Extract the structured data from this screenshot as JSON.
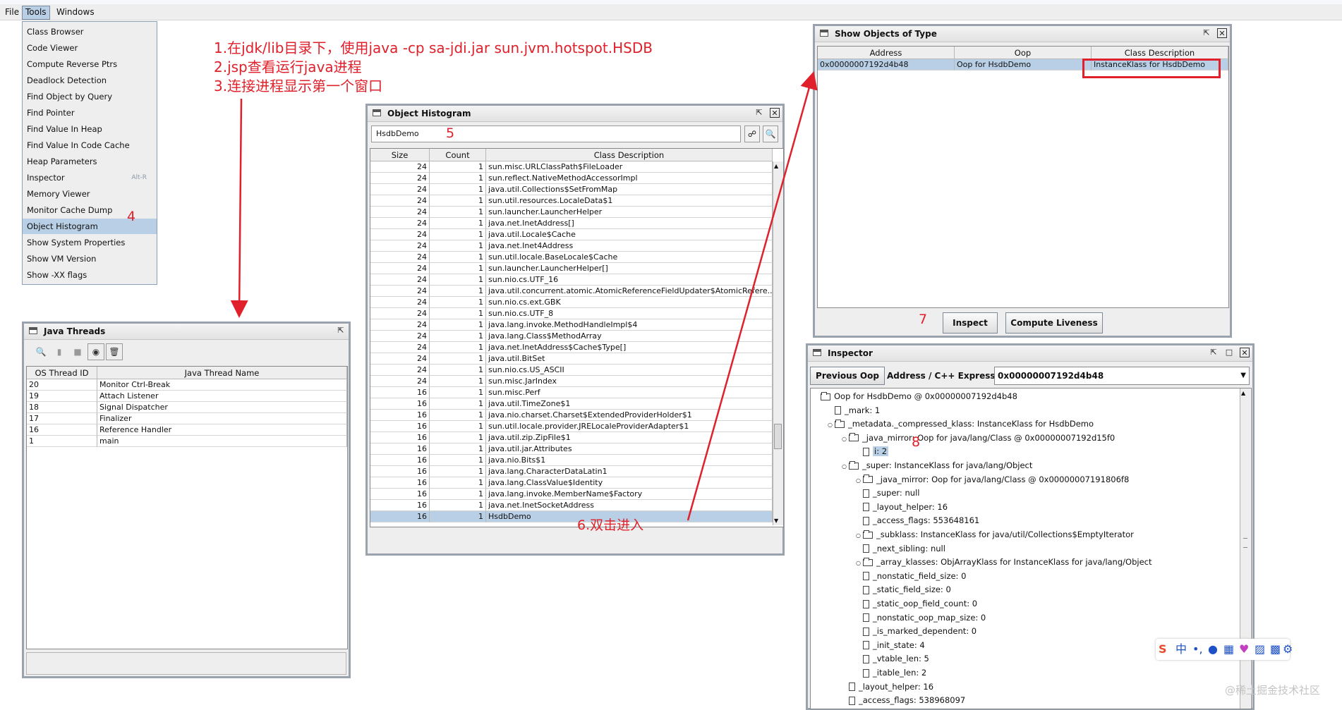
{
  "menubar": {
    "items": [
      {
        "label": "File",
        "active": false
      },
      {
        "label": "Tools",
        "active": true
      },
      {
        "label": "Windows",
        "active": false
      }
    ]
  },
  "tools_menu": {
    "items": [
      {
        "label": "Class Browser"
      },
      {
        "label": "Code Viewer"
      },
      {
        "label": "Compute Reverse Ptrs"
      },
      {
        "label": "Deadlock Detection"
      },
      {
        "label": "Find Object by Query"
      },
      {
        "label": "Find Pointer"
      },
      {
        "label": "Find Value In Heap"
      },
      {
        "label": "Find Value In Code Cache"
      },
      {
        "label": "Heap Parameters"
      },
      {
        "label": "Inspector",
        "accelerator": "Alt-R"
      },
      {
        "label": "Memory Viewer"
      },
      {
        "label": "Monitor Cache Dump"
      },
      {
        "label": "Object Histogram",
        "selected": true
      },
      {
        "label": "Show System Properties"
      },
      {
        "label": "Show VM Version"
      },
      {
        "label": "Show -XX flags"
      }
    ]
  },
  "annotations": {
    "steps_line1": "1.在jdk/lib目录下，使用java -cp sa-jdi.jar sun.jvm.hotspot.HSDB",
    "steps_line2": "2.jsp查看运行java进程",
    "steps_line3": "3.连接进程显示第一个窗口",
    "n4": "4",
    "n5": "5",
    "n6": "6.双击进入",
    "n7": "7",
    "n8": "8",
    "color": "#e0202a"
  },
  "java_threads": {
    "title": "Java Threads",
    "columns": [
      "OS Thread ID",
      "Java Thread Name"
    ],
    "rows": [
      [
        "20",
        "Monitor Ctrl-Break"
      ],
      [
        "19",
        "Attach Listener"
      ],
      [
        "18",
        "Signal Dispatcher"
      ],
      [
        "17",
        "Finalizer"
      ],
      [
        "16",
        "Reference Handler"
      ],
      [
        "1",
        "main"
      ]
    ]
  },
  "histogram": {
    "title": "Object Histogram",
    "search_value": "HsdbDemo",
    "columns": [
      "Size",
      "Count",
      "Class Description"
    ],
    "rows": [
      [
        "24",
        "1",
        "sun.misc.URLClassPath$FileLoader"
      ],
      [
        "24",
        "1",
        "sun.reflect.NativeMethodAccessorImpl"
      ],
      [
        "24",
        "1",
        "java.util.Collections$SetFromMap"
      ],
      [
        "24",
        "1",
        "sun.util.resources.LocaleData$1"
      ],
      [
        "24",
        "1",
        "sun.launcher.LauncherHelper"
      ],
      [
        "24",
        "1",
        "java.net.InetAddress[]"
      ],
      [
        "24",
        "1",
        "java.util.Locale$Cache"
      ],
      [
        "24",
        "1",
        "java.net.Inet4Address"
      ],
      [
        "24",
        "1",
        "sun.util.locale.BaseLocale$Cache"
      ],
      [
        "24",
        "1",
        "sun.launcher.LauncherHelper[]"
      ],
      [
        "24",
        "1",
        "sun.nio.cs.UTF_16"
      ],
      [
        "24",
        "1",
        "java.util.concurrent.atomic.AtomicReferenceFieldUpdater$AtomicRefere..."
      ],
      [
        "24",
        "1",
        "sun.nio.cs.ext.GBK"
      ],
      [
        "24",
        "1",
        "sun.nio.cs.UTF_8"
      ],
      [
        "24",
        "1",
        "java.lang.invoke.MethodHandleImpl$4"
      ],
      [
        "24",
        "1",
        "java.lang.Class$MethodArray"
      ],
      [
        "24",
        "1",
        "java.net.InetAddress$Cache$Type[]"
      ],
      [
        "24",
        "1",
        "java.util.BitSet"
      ],
      [
        "24",
        "1",
        "sun.nio.cs.US_ASCII"
      ],
      [
        "24",
        "1",
        "sun.misc.JarIndex"
      ],
      [
        "16",
        "1",
        "sun.misc.Perf"
      ],
      [
        "16",
        "1",
        "java.util.TimeZone$1"
      ],
      [
        "16",
        "1",
        "java.nio.charset.Charset$ExtendedProviderHolder$1"
      ],
      [
        "16",
        "1",
        "sun.util.locale.provider.JRELocaleProviderAdapter$1"
      ],
      [
        "16",
        "1",
        "java.util.zip.ZipFile$1"
      ],
      [
        "16",
        "1",
        "java.util.jar.Attributes"
      ],
      [
        "16",
        "1",
        "java.nio.Bits$1"
      ],
      [
        "16",
        "1",
        "java.lang.CharacterDataLatin1"
      ],
      [
        "16",
        "1",
        "java.lang.ClassValue$Identity"
      ],
      [
        "16",
        "1",
        "java.lang.invoke.MemberName$Factory"
      ],
      [
        "16",
        "1",
        "java.net.InetSocketAddress"
      ],
      [
        "16",
        "1",
        "HsdbDemo"
      ]
    ],
    "selected_row": 31
  },
  "show_objects": {
    "title": "Show Objects of Type",
    "columns": [
      "Address",
      "Oop",
      "Class Description"
    ],
    "rows": [
      [
        "0x00000007192d4b48",
        "Oop for HsdbDemo",
        "InstanceKlass for HsdbDemo"
      ]
    ],
    "inspect_label": "Inspect",
    "compute_label": "Compute Liveness"
  },
  "inspector": {
    "title": "Inspector",
    "prev_label": "Previous Oop",
    "expr_label": "Address / C++ Expression:",
    "expr_value": "0x00000007192d4b48",
    "tree": [
      {
        "indent": 0,
        "icon": "folder",
        "exp": "",
        "text": "Oop for HsdbDemo @ 0x00000007192d4b48"
      },
      {
        "indent": 1,
        "icon": "doc",
        "exp": "",
        "text": "_mark: 1"
      },
      {
        "indent": 1,
        "icon": "folder",
        "exp": "o",
        "text": "_metadata._compressed_klass: InstanceKlass for HsdbDemo"
      },
      {
        "indent": 2,
        "icon": "folder",
        "exp": "o",
        "text": "_java_mirror: Oop for java/lang/Class @ 0x00000007192d15f0"
      },
      {
        "indent": 3,
        "icon": "doc",
        "exp": "",
        "text": "i: 2",
        "hl": true
      },
      {
        "indent": 2,
        "icon": "folder",
        "exp": "o",
        "text": "_super: InstanceKlass for java/lang/Object"
      },
      {
        "indent": 3,
        "icon": "folder",
        "exp": "o",
        "text": "_java_mirror: Oop for java/lang/Class @ 0x00000007191806f8"
      },
      {
        "indent": 3,
        "icon": "doc",
        "exp": "",
        "text": "_super: null"
      },
      {
        "indent": 3,
        "icon": "doc",
        "exp": "",
        "text": "_layout_helper: 16"
      },
      {
        "indent": 3,
        "icon": "doc",
        "exp": "",
        "text": "_access_flags: 553648161"
      },
      {
        "indent": 3,
        "icon": "folder",
        "exp": "o",
        "text": "_subklass: InstanceKlass for java/util/Collections$EmptyIterator"
      },
      {
        "indent": 3,
        "icon": "doc",
        "exp": "",
        "text": "_next_sibling: null"
      },
      {
        "indent": 3,
        "icon": "folder",
        "exp": "o",
        "text": "_array_klasses: ObjArrayKlass for InstanceKlass for java/lang/Object"
      },
      {
        "indent": 3,
        "icon": "doc",
        "exp": "",
        "text": "_nonstatic_field_size: 0"
      },
      {
        "indent": 3,
        "icon": "doc",
        "exp": "",
        "text": "_static_field_size: 0"
      },
      {
        "indent": 3,
        "icon": "doc",
        "exp": "",
        "text": "_static_oop_field_count: 0"
      },
      {
        "indent": 3,
        "icon": "doc",
        "exp": "",
        "text": "_nonstatic_oop_map_size: 0"
      },
      {
        "indent": 3,
        "icon": "doc",
        "exp": "",
        "text": "_is_marked_dependent: 0"
      },
      {
        "indent": 3,
        "icon": "doc",
        "exp": "",
        "text": "_init_state: 4"
      },
      {
        "indent": 3,
        "icon": "doc",
        "exp": "",
        "text": "_vtable_len: 5"
      },
      {
        "indent": 3,
        "icon": "doc",
        "exp": "",
        "text": "_itable_len: 2"
      },
      {
        "indent": 2,
        "icon": "doc",
        "exp": "",
        "text": "_layout_helper: 16"
      },
      {
        "indent": 2,
        "icon": "doc",
        "exp": "",
        "text": "_access_flags: 538968097"
      }
    ]
  },
  "ime": {
    "label": "中"
  },
  "watermark": "@稀土掘金技术社区"
}
